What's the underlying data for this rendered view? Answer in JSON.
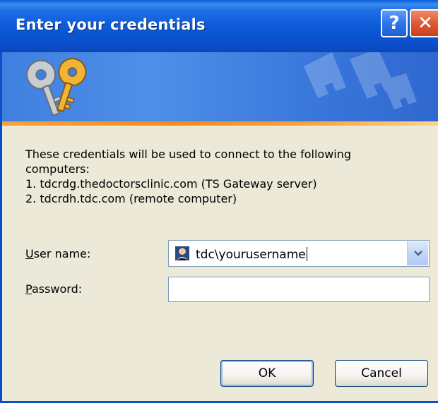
{
  "window": {
    "title": "Enter your credentials",
    "help_glyph": "?",
    "close_glyph": "✕"
  },
  "banner": {
    "icon": "keys-icon"
  },
  "message": {
    "lines": [
      "These credentials will be used to connect to the following",
      "computers:",
      "1. tdcrdg.thedoctorsclinic.com (TS Gateway server)",
      "2. tdcrdh.tdc.com (remote computer)"
    ]
  },
  "form": {
    "username_label_accel": "U",
    "username_label_rest": "ser name:",
    "username_value": "tdc\\yourusername",
    "password_label_accel": "P",
    "password_label_rest": "assword:",
    "password_value": ""
  },
  "buttons": {
    "ok": "OK",
    "cancel": "Cancel"
  },
  "colors": {
    "title_bar": "#0a5fd8",
    "banner": "#3f7fe0",
    "accent_stripe": "#f08c1e",
    "dialog_bg": "#ece9d8",
    "close_button": "#e05a34"
  }
}
